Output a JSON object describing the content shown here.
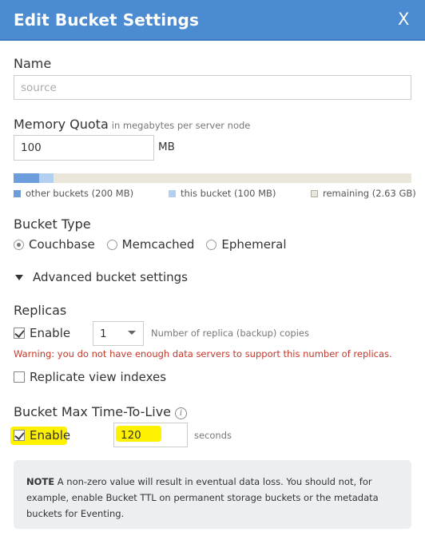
{
  "dialog": {
    "title": "Edit Bucket Settings",
    "close_label": "X"
  },
  "name": {
    "label": "Name",
    "placeholder": "source",
    "value": ""
  },
  "memory_quota": {
    "label": "Memory Quota",
    "sublabel": "in megabytes per server node",
    "value": "100",
    "unit": "MB",
    "usage": {
      "other_fraction": 0.064,
      "this_fraction": 0.037,
      "other_color": "#6b9edb",
      "this_color": "#b3d0f0",
      "remaining_color": "#ebe6dc"
    },
    "legend": {
      "other": "other buckets (200 MB)",
      "this": "this bucket (100 MB)",
      "remaining": "remaining (2.63 GB)"
    }
  },
  "bucket_type": {
    "label": "Bucket Type",
    "options": [
      "Couchbase",
      "Memcached",
      "Ephemeral"
    ],
    "selected": "Couchbase"
  },
  "advanced": {
    "label": "Advanced bucket settings",
    "expanded": true
  },
  "replicas": {
    "label": "Replicas",
    "enable_label": "Enable",
    "enabled": true,
    "count": "1",
    "count_hint": "Number of replica (backup) copies",
    "warning": "Warning: you do not have enough data servers to support this number of replicas.",
    "view_index_label": "Replicate view indexes",
    "view_index_checked": false
  },
  "ttl": {
    "label": "Bucket Max Time-To-Live",
    "info_icon": "i",
    "enable_label": "Enable",
    "enabled": true,
    "value": "120",
    "unit": "seconds",
    "highlight_color": "#fff200"
  },
  "note": {
    "prefix": "NOTE",
    "text": "A non-zero value will result in eventual data loss. You should not, for example, enable Bucket TTL on permanent storage buckets or the metadata buckets for Eventing."
  }
}
